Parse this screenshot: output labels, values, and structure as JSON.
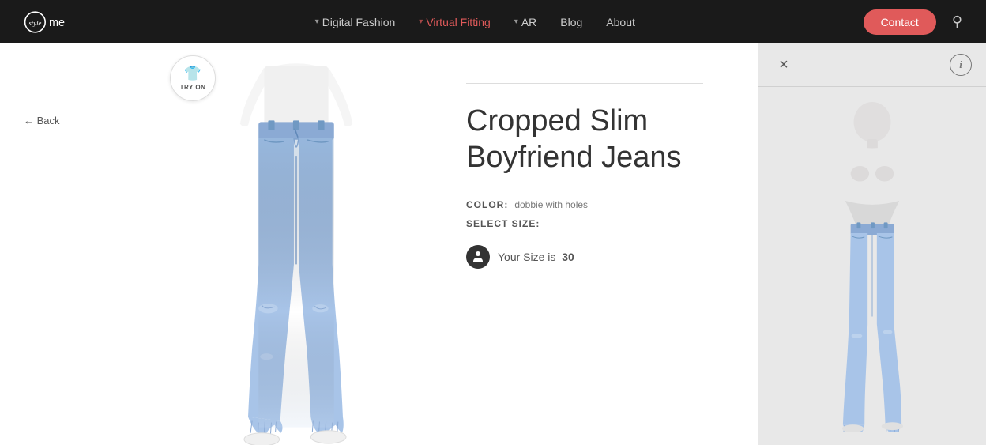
{
  "navbar": {
    "logo_alt": "StyleMe",
    "nav_items": [
      {
        "label": "Digital Fashion",
        "active": false,
        "has_dropdown": true
      },
      {
        "label": "Virtual Fitting",
        "active": true,
        "has_dropdown": true
      },
      {
        "label": "AR",
        "active": false,
        "has_dropdown": true
      },
      {
        "label": "Blog",
        "active": false,
        "has_dropdown": false
      },
      {
        "label": "About",
        "active": false,
        "has_dropdown": false
      }
    ],
    "contact_label": "Contact",
    "search_icon": "🔍"
  },
  "product": {
    "back_label": "← Back",
    "title": "Cropped Slim Boyfriend Jeans",
    "try_on_label": "TRY ON",
    "color_key": "COLOR:",
    "color_value": "dobbie with holes",
    "size_key": "SELECT SIZE:",
    "size_recommendation": "Your Size is",
    "size_value": "30"
  },
  "fitting_room": {
    "close_icon": "×",
    "info_icon": "i"
  }
}
